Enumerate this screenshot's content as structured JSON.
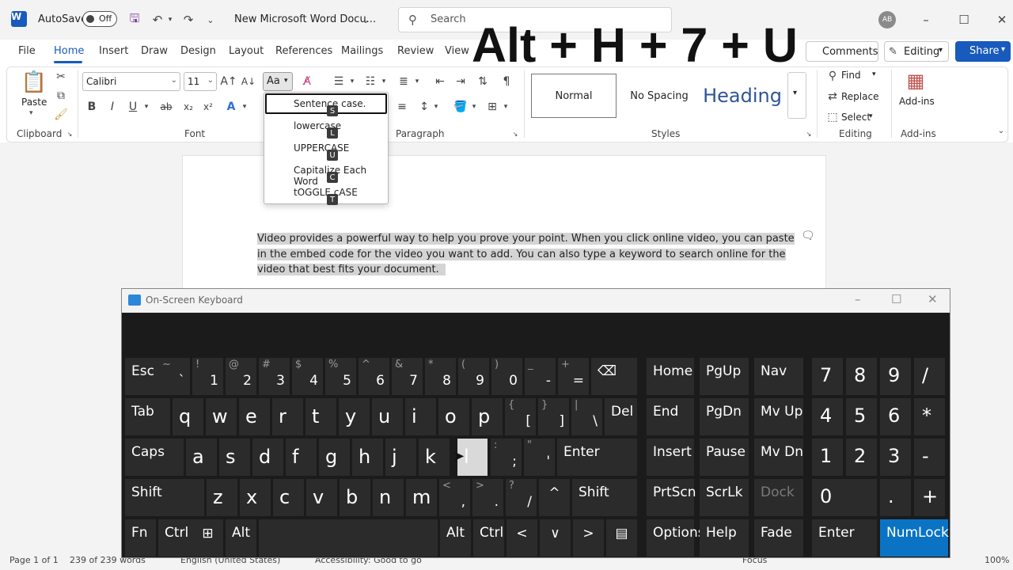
{
  "titlebar": {
    "app_icon": "W",
    "autosave_label": "AutoSave",
    "autosave_state": "Off",
    "doc_title": "New Microsoft Word Docu...",
    "search_placeholder": "Search",
    "avatar_initials": "AB"
  },
  "overlay": {
    "shortcut": "Alt + H + 7 + U"
  },
  "menu": {
    "tabs": [
      "File",
      "Home",
      "Insert",
      "Draw",
      "Design",
      "Layout",
      "References",
      "Mailings",
      "Review",
      "View"
    ],
    "active": "Home",
    "comments": "Comments",
    "editing": "Editing",
    "share": "Share"
  },
  "ribbon": {
    "clipboard": {
      "paste": "Paste",
      "label": "Clipboard"
    },
    "font": {
      "name": "Calibri",
      "size": "11",
      "change_case": "Aa",
      "label": "Font",
      "bold": "B",
      "italic": "I",
      "underline": "U",
      "strike": "ab",
      "subscript": "x₂",
      "superscript": "x²"
    },
    "paragraph": {
      "label": "Paragraph"
    },
    "styles": {
      "items": [
        "Normal",
        "No Spacing",
        "Heading"
      ],
      "label": "Styles"
    },
    "editing": {
      "find": "Find",
      "replace": "Replace",
      "select": "Select",
      "label": "Editing"
    },
    "addins": {
      "button": "Add-ins",
      "label": "Add-ins"
    }
  },
  "case_menu": {
    "items": [
      {
        "label": "Sentence case.",
        "tip": "S"
      },
      {
        "label": "lowercase",
        "tip": "L"
      },
      {
        "label": "UPPERCASE",
        "tip": "U"
      },
      {
        "label": "Capitalize Each Word",
        "tip": "C"
      },
      {
        "label": "tOGGLE cASE",
        "tip": "T"
      }
    ]
  },
  "document": {
    "lines": [
      "Video provides a powerful way to help you prove your point. When you click online video, you can paste",
      "in the embed code for the video you want to add. You can also type a keyword to search online for the",
      "video that best fits your document."
    ]
  },
  "statusbar": {
    "page": "Page 1 of 1",
    "words": "239 of 239 words",
    "language": "English (United States)",
    "accessibility": "Accessibility: Good to go",
    "focus": "Focus",
    "zoom": "100%"
  },
  "osk": {
    "title": "On-Screen Keyboard",
    "rows": [
      [
        [
          "Esc",
          ""
        ],
        [
          "~",
          "`"
        ],
        [
          "!",
          "1"
        ],
        [
          "@",
          "2"
        ],
        [
          "#",
          "3"
        ],
        [
          "$",
          "4"
        ],
        [
          "%",
          "5"
        ],
        [
          "^",
          "6"
        ],
        [
          "&",
          "7"
        ],
        [
          "*",
          "8"
        ],
        [
          "(",
          "9"
        ],
        [
          ")",
          "0"
        ],
        [
          "_",
          "-"
        ],
        [
          "+",
          "="
        ],
        [
          "⌫",
          ""
        ]
      ],
      [
        [
          "Tab",
          ""
        ],
        [
          "q",
          ""
        ],
        [
          "w",
          ""
        ],
        [
          "e",
          ""
        ],
        [
          "r",
          ""
        ],
        [
          "t",
          ""
        ],
        [
          "y",
          ""
        ],
        [
          "u",
          ""
        ],
        [
          "i",
          ""
        ],
        [
          "o",
          ""
        ],
        [
          "p",
          ""
        ],
        [
          "{",
          "["
        ],
        [
          "}",
          "]"
        ],
        [
          "|",
          "\\"
        ],
        [
          "Del",
          ""
        ]
      ],
      [
        [
          "Caps",
          ""
        ],
        [
          "a",
          ""
        ],
        [
          "s",
          ""
        ],
        [
          "d",
          ""
        ],
        [
          "f",
          ""
        ],
        [
          "g",
          ""
        ],
        [
          "h",
          ""
        ],
        [
          "j",
          ""
        ],
        [
          "k",
          ""
        ],
        [
          "l",
          ""
        ],
        [
          ":",
          ";"
        ],
        [
          "\"",
          "'"
        ],
        [
          "Enter",
          ""
        ]
      ],
      [
        [
          "Shift",
          ""
        ],
        [
          "z",
          ""
        ],
        [
          "x",
          ""
        ],
        [
          "c",
          ""
        ],
        [
          "v",
          ""
        ],
        [
          "b",
          ""
        ],
        [
          "n",
          ""
        ],
        [
          "m",
          ""
        ],
        [
          "<",
          ","
        ],
        [
          ">",
          "."
        ],
        [
          "?",
          "/"
        ],
        [
          "^",
          ""
        ],
        [
          "Shift",
          ""
        ]
      ],
      [
        [
          "Fn",
          ""
        ],
        [
          "Ctrl",
          ""
        ],
        [
          "⊞",
          ""
        ],
        [
          "Alt",
          ""
        ],
        [
          "",
          ""
        ],
        [
          "Alt",
          ""
        ],
        [
          "Ctrl",
          ""
        ],
        [
          "<",
          ""
        ],
        [
          "∨",
          ""
        ],
        [
          ">",
          ""
        ],
        [
          "▤",
          ""
        ]
      ]
    ],
    "nav": [
      [
        "Home",
        "PgUp",
        "Nav"
      ],
      [
        "End",
        "PgDn",
        "Mv Up"
      ],
      [
        "Insert",
        "Pause",
        "Mv Dn"
      ],
      [
        "PrtScn",
        "ScrLk",
        "Dock"
      ],
      [
        "Options",
        "Help",
        "Fade"
      ]
    ],
    "numpad": [
      [
        "7",
        "8",
        "9",
        "/"
      ],
      [
        "4",
        "5",
        "6",
        "*"
      ],
      [
        "1",
        "2",
        "3",
        "-"
      ],
      [
        "0",
        ".",
        "+"
      ],
      [
        "Enter",
        "NumLock"
      ]
    ]
  }
}
